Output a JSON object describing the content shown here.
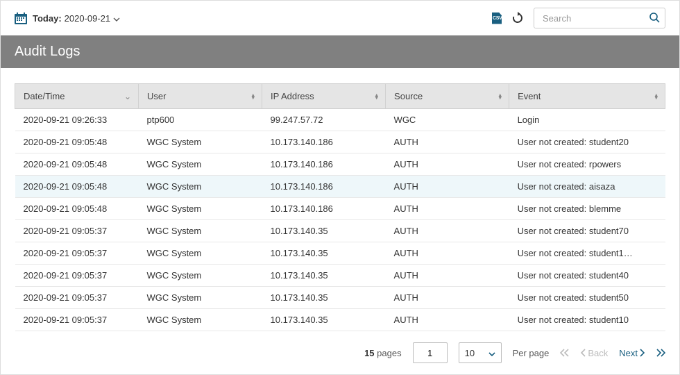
{
  "toolbar": {
    "date_prefix": "Today:",
    "date_value": "2020-09-21",
    "csv_label": "CSV",
    "search_placeholder": "Search"
  },
  "title": "Audit Logs",
  "columns": {
    "datetime": "Date/Time",
    "user": "User",
    "ip": "IP Address",
    "source": "Source",
    "event": "Event"
  },
  "rows": [
    {
      "dt": "2020-09-21 09:26:33",
      "user": "ptp600",
      "ip": "99.247.57.72",
      "source": "WGC",
      "event": "Login",
      "hl": false
    },
    {
      "dt": "2020-09-21 09:05:48",
      "user": "WGC System",
      "ip": "10.173.140.186",
      "source": "AUTH",
      "event": "User not created: student20",
      "hl": false
    },
    {
      "dt": "2020-09-21 09:05:48",
      "user": "WGC System",
      "ip": "10.173.140.186",
      "source": "AUTH",
      "event": "User not created: rpowers",
      "hl": false
    },
    {
      "dt": "2020-09-21 09:05:48",
      "user": "WGC System",
      "ip": "10.173.140.186",
      "source": "AUTH",
      "event": "User not created: aisaza",
      "hl": true
    },
    {
      "dt": "2020-09-21 09:05:48",
      "user": "WGC System",
      "ip": "10.173.140.186",
      "source": "AUTH",
      "event": "User not created: blemme",
      "hl": false
    },
    {
      "dt": "2020-09-21 09:05:37",
      "user": "WGC System",
      "ip": "10.173.140.35",
      "source": "AUTH",
      "event": "User not created: student70",
      "hl": false
    },
    {
      "dt": "2020-09-21 09:05:37",
      "user": "WGC System",
      "ip": "10.173.140.35",
      "source": "AUTH",
      "event": "User not created: student1…",
      "hl": false
    },
    {
      "dt": "2020-09-21 09:05:37",
      "user": "WGC System",
      "ip": "10.173.140.35",
      "source": "AUTH",
      "event": "User not created: student40",
      "hl": false
    },
    {
      "dt": "2020-09-21 09:05:37",
      "user": "WGC System",
      "ip": "10.173.140.35",
      "source": "AUTH",
      "event": "User not created: student50",
      "hl": false
    },
    {
      "dt": "2020-09-21 09:05:37",
      "user": "WGC System",
      "ip": "10.173.140.35",
      "source": "AUTH",
      "event": "User not created: student10",
      "hl": false
    }
  ],
  "pager": {
    "total_pages": "15",
    "pages_label": "pages",
    "current_page": "1",
    "per_page_value": "10",
    "per_page_label": "Per page",
    "back_label": "Back",
    "next_label": "Next"
  }
}
